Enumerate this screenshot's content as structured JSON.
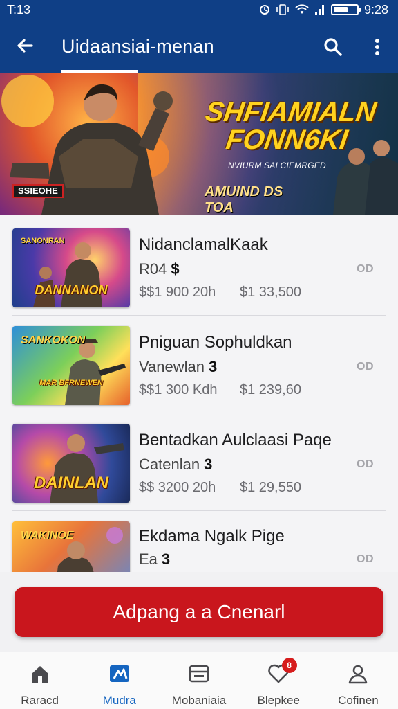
{
  "status_bar": {
    "time_left": "T:13",
    "time_right": "9:28",
    "battery_level": 0.62
  },
  "app_bar": {
    "title": "Uidaansiai-menan"
  },
  "banner": {
    "title_line1": "SHFIAMIALN",
    "title_line2": "FONN6KI",
    "subtitle": "NVIURM SAI CIEMRGED",
    "cta_text": "AMUIND DS TOA",
    "tag": "SSIEOHE"
  },
  "games": [
    {
      "thumb_label": "DANNANON",
      "thumb_top": "SANONRAN",
      "title": "NidanclamalKaak",
      "subtitle": "R04",
      "price": "$$1 900 20h",
      "alt_price": "$1 33,500",
      "badge": "OD"
    },
    {
      "thumb_label": "MAR BFRNEWEN",
      "thumb_top": "SANKOKON",
      "title": "Pniguan Sophuldkan",
      "subtitle": "Vanewlan",
      "price": "$$1 300 Kdh",
      "alt_price": "$1 239,60",
      "badge": "OD"
    },
    {
      "thumb_label": "DAINLAN",
      "thumb_top": "",
      "title": "Bentadkan Aulclaasi Paqe",
      "subtitle": "Catenlan",
      "price": "$$ 3200 20h",
      "alt_price": "$1 29,550",
      "badge": "OD"
    },
    {
      "thumb_label": "",
      "thumb_top": "WAKINOE",
      "title": "Ekdama Ngalk Pige",
      "subtitle": "Ea",
      "price": "",
      "alt_price": "",
      "badge": "OD"
    }
  ],
  "primary_button": {
    "label": "Adpang a a Cnenarl"
  },
  "bottom_nav": {
    "items": [
      {
        "label": "Raracd",
        "icon": "home-icon"
      },
      {
        "label": "Mudra",
        "icon": "store-icon",
        "active": true
      },
      {
        "label": "Mobaniaia",
        "icon": "wallet-icon"
      },
      {
        "label": "Blepkee",
        "icon": "heart-icon",
        "badge": "8"
      },
      {
        "label": "Cofinen",
        "icon": "user-icon"
      }
    ]
  },
  "colors": {
    "primary_bar": "#0f3f86",
    "cta_red": "#c9161d",
    "active_nav": "#1565c0"
  }
}
